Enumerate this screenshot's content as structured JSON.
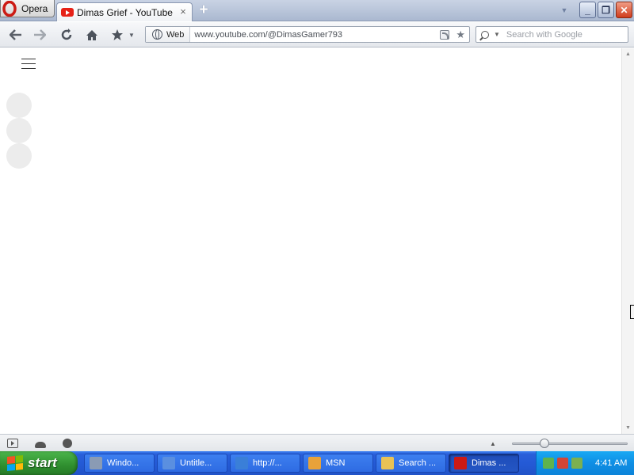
{
  "browser": {
    "menu_label": "Opera",
    "tab": {
      "title": "Dimas Grief - YouTube",
      "close_glyph": "×"
    },
    "new_tab_glyph": "+",
    "window_controls": {
      "minimize": "_",
      "maximize": "❐",
      "close": "✕"
    }
  },
  "toolbar": {
    "back_icon": "arrow-left-icon",
    "forward_icon": "arrow-right-icon",
    "reload_icon": "reload-icon",
    "home_icon": "home-icon",
    "bookmarks_icon": "star-icon",
    "address": {
      "badge_label": "Web",
      "url": "www.youtube.com/@DimasGamer793"
    },
    "search": {
      "placeholder": "Search with Google"
    }
  },
  "page": {
    "skeleton_avatars": 3
  },
  "taskbar": {
    "start_label": "start",
    "tasks": [
      {
        "label": "Windo...",
        "color": "#8a9bb4",
        "active": false
      },
      {
        "label": "Untitle...",
        "color": "#5a8fe0",
        "active": false
      },
      {
        "label": "http://...",
        "color": "#3a7fd8",
        "active": false
      },
      {
        "label": "MSN",
        "color": "#e8a23a",
        "active": false
      },
      {
        "label": "Search ...",
        "color": "#e8c255",
        "active": false
      },
      {
        "label": "Dimas ...",
        "color": "#cc1a14",
        "active": true
      }
    ],
    "clock": "4:41 AM"
  },
  "colors": {
    "taskbar_blue": "#245ad6",
    "start_green": "#2f8f2f",
    "youtube_red": "#e62117",
    "opera_red": "#cc1a14"
  }
}
